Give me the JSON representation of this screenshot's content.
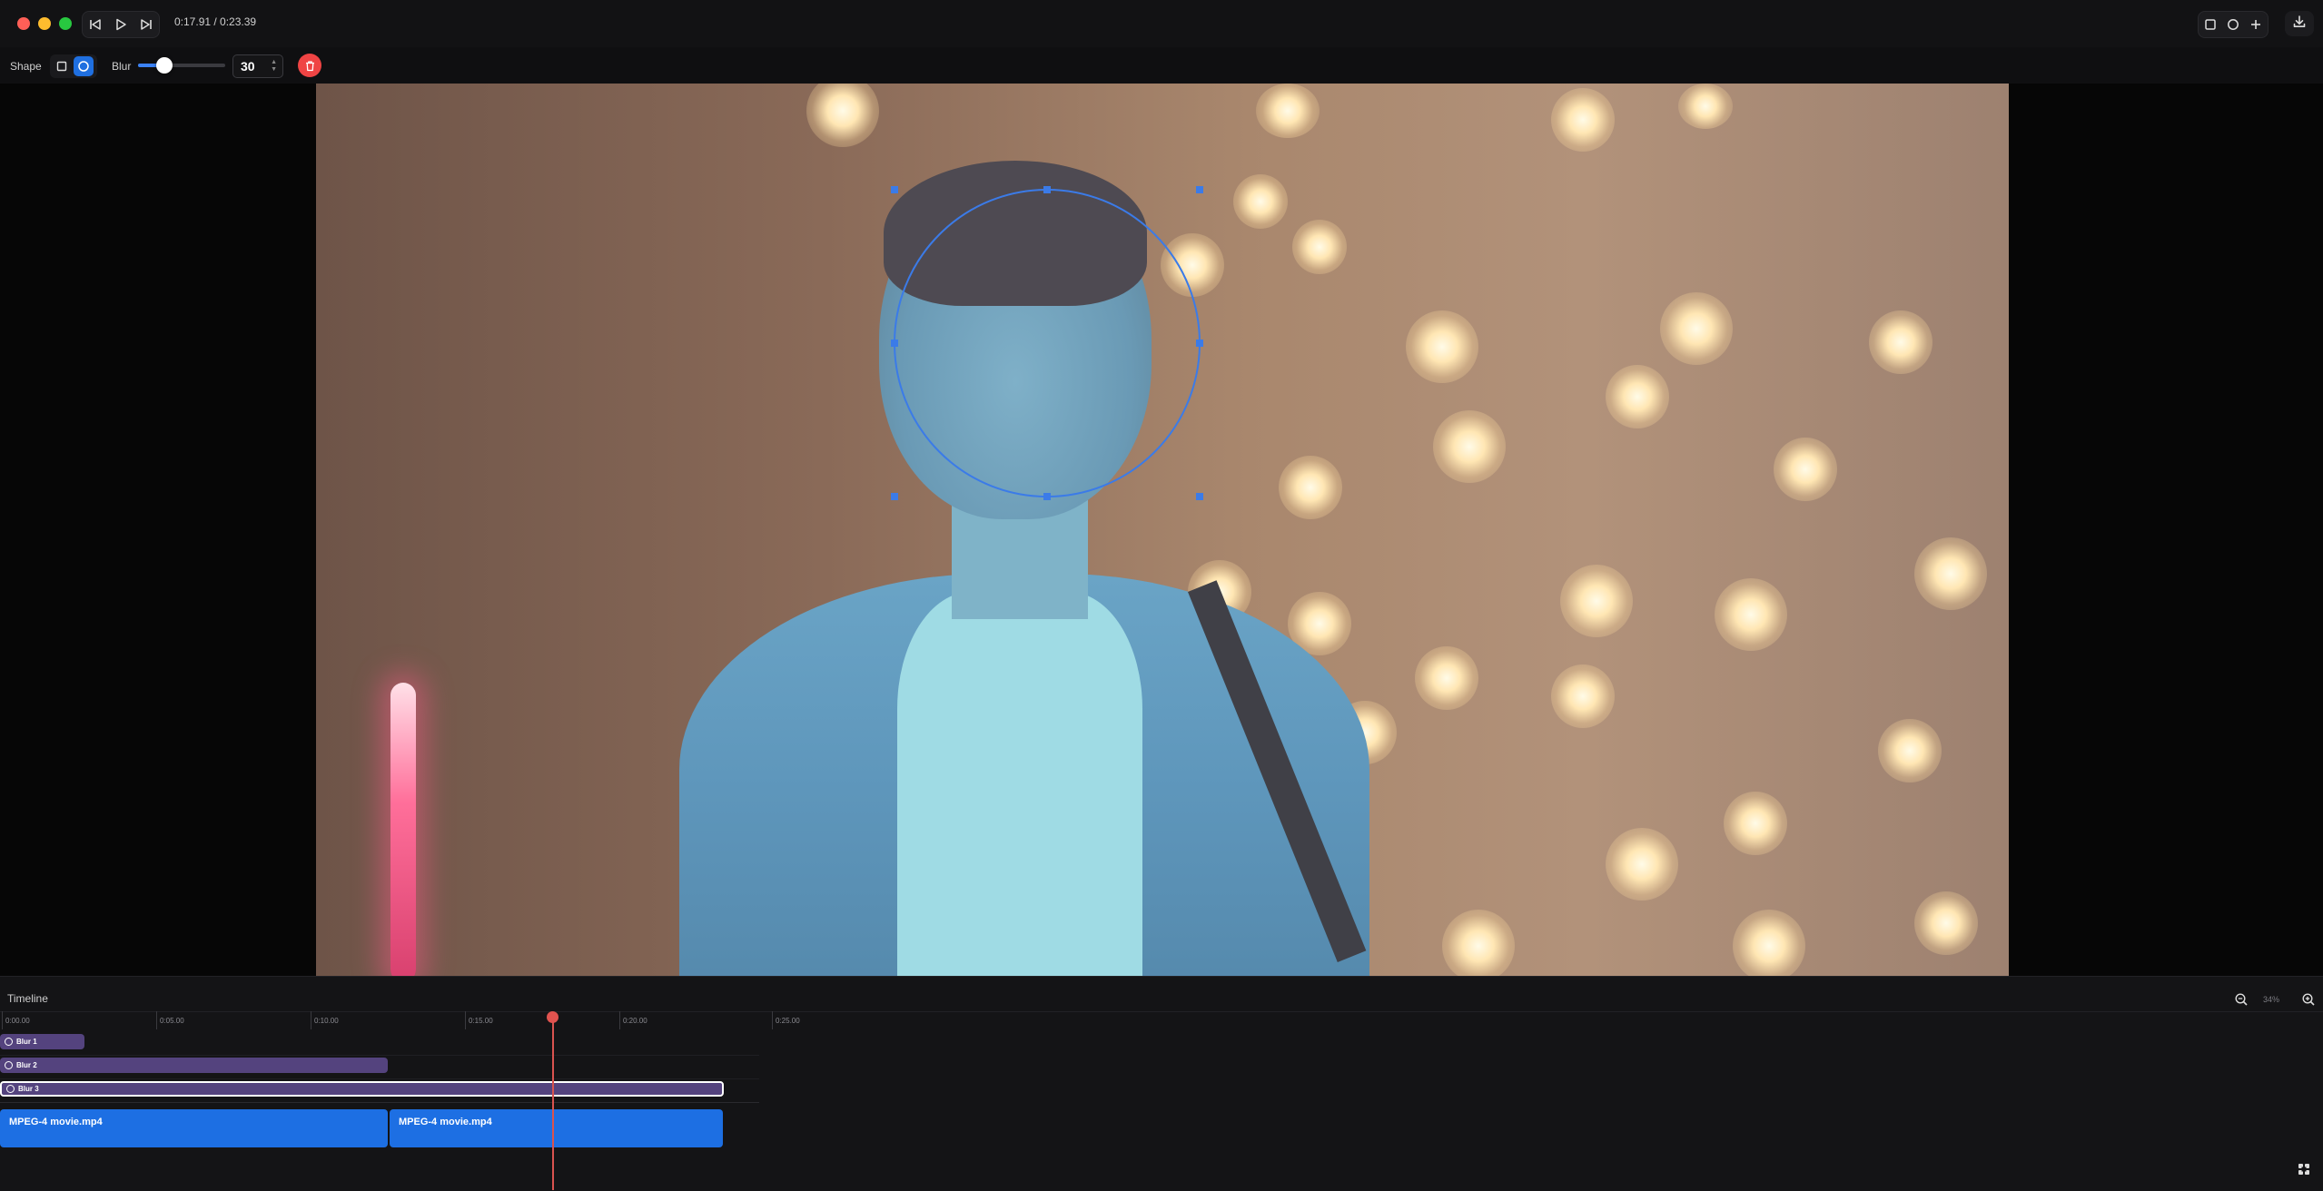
{
  "window": {
    "timecode": "0:17.91 / 0:23.39"
  },
  "toolbar": {
    "shape_label": "Shape",
    "blur_label": "Blur",
    "blur_value": "30",
    "blur_fraction": 0.3
  },
  "timeline": {
    "title": "Timeline",
    "zoom_label": "34%",
    "ruler_ticks": [
      "0:00.00",
      "0:05.00",
      "0:10.00",
      "0:15.00",
      "0:20.00",
      "0:25.00"
    ],
    "blur_tracks": [
      {
        "name": "Blur 1",
        "selected": false
      },
      {
        "name": "Blur 2",
        "selected": false
      },
      {
        "name": "Blur 3",
        "selected": true
      }
    ],
    "video_clips": [
      {
        "name": "MPEG-4 movie.mp4"
      },
      {
        "name": "MPEG-4 movie.mp4"
      }
    ]
  },
  "colors": {
    "accent": "#1d6fe3",
    "blur_clip": "#54437e",
    "playhead": "#e0534f",
    "delete": "#ef4444"
  },
  "icons": {
    "transport": [
      "skip-back-icon",
      "play-icon",
      "skip-forward-icon"
    ],
    "shapes": [
      "square-icon",
      "circle-icon",
      "plus-icon"
    ],
    "export": "download-icon",
    "delete": "trash-icon",
    "zoom": [
      "zoom-out-icon",
      "zoom-in-icon"
    ],
    "corner": "expand-icon"
  }
}
